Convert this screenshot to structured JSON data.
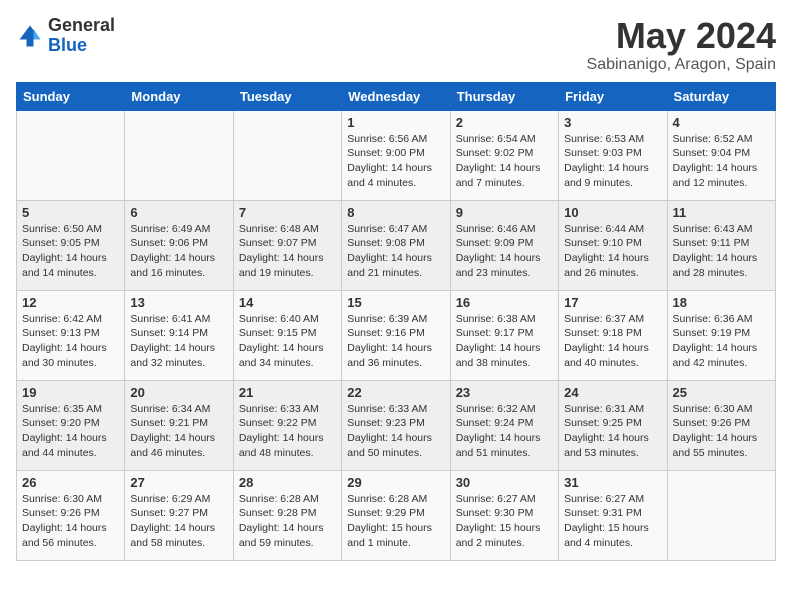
{
  "header": {
    "logo_general": "General",
    "logo_blue": "Blue",
    "month_title": "May 2024",
    "subtitle": "Sabinanigo, Aragon, Spain"
  },
  "days_of_week": [
    "Sunday",
    "Monday",
    "Tuesday",
    "Wednesday",
    "Thursday",
    "Friday",
    "Saturday"
  ],
  "weeks": [
    [
      {
        "day": "",
        "info": ""
      },
      {
        "day": "",
        "info": ""
      },
      {
        "day": "",
        "info": ""
      },
      {
        "day": "1",
        "info": "Sunrise: 6:56 AM\nSunset: 9:00 PM\nDaylight: 14 hours\nand 4 minutes."
      },
      {
        "day": "2",
        "info": "Sunrise: 6:54 AM\nSunset: 9:02 PM\nDaylight: 14 hours\nand 7 minutes."
      },
      {
        "day": "3",
        "info": "Sunrise: 6:53 AM\nSunset: 9:03 PM\nDaylight: 14 hours\nand 9 minutes."
      },
      {
        "day": "4",
        "info": "Sunrise: 6:52 AM\nSunset: 9:04 PM\nDaylight: 14 hours\nand 12 minutes."
      }
    ],
    [
      {
        "day": "5",
        "info": "Sunrise: 6:50 AM\nSunset: 9:05 PM\nDaylight: 14 hours\nand 14 minutes."
      },
      {
        "day": "6",
        "info": "Sunrise: 6:49 AM\nSunset: 9:06 PM\nDaylight: 14 hours\nand 16 minutes."
      },
      {
        "day": "7",
        "info": "Sunrise: 6:48 AM\nSunset: 9:07 PM\nDaylight: 14 hours\nand 19 minutes."
      },
      {
        "day": "8",
        "info": "Sunrise: 6:47 AM\nSunset: 9:08 PM\nDaylight: 14 hours\nand 21 minutes."
      },
      {
        "day": "9",
        "info": "Sunrise: 6:46 AM\nSunset: 9:09 PM\nDaylight: 14 hours\nand 23 minutes."
      },
      {
        "day": "10",
        "info": "Sunrise: 6:44 AM\nSunset: 9:10 PM\nDaylight: 14 hours\nand 26 minutes."
      },
      {
        "day": "11",
        "info": "Sunrise: 6:43 AM\nSunset: 9:11 PM\nDaylight: 14 hours\nand 28 minutes."
      }
    ],
    [
      {
        "day": "12",
        "info": "Sunrise: 6:42 AM\nSunset: 9:13 PM\nDaylight: 14 hours\nand 30 minutes."
      },
      {
        "day": "13",
        "info": "Sunrise: 6:41 AM\nSunset: 9:14 PM\nDaylight: 14 hours\nand 32 minutes."
      },
      {
        "day": "14",
        "info": "Sunrise: 6:40 AM\nSunset: 9:15 PM\nDaylight: 14 hours\nand 34 minutes."
      },
      {
        "day": "15",
        "info": "Sunrise: 6:39 AM\nSunset: 9:16 PM\nDaylight: 14 hours\nand 36 minutes."
      },
      {
        "day": "16",
        "info": "Sunrise: 6:38 AM\nSunset: 9:17 PM\nDaylight: 14 hours\nand 38 minutes."
      },
      {
        "day": "17",
        "info": "Sunrise: 6:37 AM\nSunset: 9:18 PM\nDaylight: 14 hours\nand 40 minutes."
      },
      {
        "day": "18",
        "info": "Sunrise: 6:36 AM\nSunset: 9:19 PM\nDaylight: 14 hours\nand 42 minutes."
      }
    ],
    [
      {
        "day": "19",
        "info": "Sunrise: 6:35 AM\nSunset: 9:20 PM\nDaylight: 14 hours\nand 44 minutes."
      },
      {
        "day": "20",
        "info": "Sunrise: 6:34 AM\nSunset: 9:21 PM\nDaylight: 14 hours\nand 46 minutes."
      },
      {
        "day": "21",
        "info": "Sunrise: 6:33 AM\nSunset: 9:22 PM\nDaylight: 14 hours\nand 48 minutes."
      },
      {
        "day": "22",
        "info": "Sunrise: 6:33 AM\nSunset: 9:23 PM\nDaylight: 14 hours\nand 50 minutes."
      },
      {
        "day": "23",
        "info": "Sunrise: 6:32 AM\nSunset: 9:24 PM\nDaylight: 14 hours\nand 51 minutes."
      },
      {
        "day": "24",
        "info": "Sunrise: 6:31 AM\nSunset: 9:25 PM\nDaylight: 14 hours\nand 53 minutes."
      },
      {
        "day": "25",
        "info": "Sunrise: 6:30 AM\nSunset: 9:26 PM\nDaylight: 14 hours\nand 55 minutes."
      }
    ],
    [
      {
        "day": "26",
        "info": "Sunrise: 6:30 AM\nSunset: 9:26 PM\nDaylight: 14 hours\nand 56 minutes."
      },
      {
        "day": "27",
        "info": "Sunrise: 6:29 AM\nSunset: 9:27 PM\nDaylight: 14 hours\nand 58 minutes."
      },
      {
        "day": "28",
        "info": "Sunrise: 6:28 AM\nSunset: 9:28 PM\nDaylight: 14 hours\nand 59 minutes."
      },
      {
        "day": "29",
        "info": "Sunrise: 6:28 AM\nSunset: 9:29 PM\nDaylight: 15 hours\nand 1 minute."
      },
      {
        "day": "30",
        "info": "Sunrise: 6:27 AM\nSunset: 9:30 PM\nDaylight: 15 hours\nand 2 minutes."
      },
      {
        "day": "31",
        "info": "Sunrise: 6:27 AM\nSunset: 9:31 PM\nDaylight: 15 hours\nand 4 minutes."
      },
      {
        "day": "",
        "info": ""
      }
    ]
  ]
}
